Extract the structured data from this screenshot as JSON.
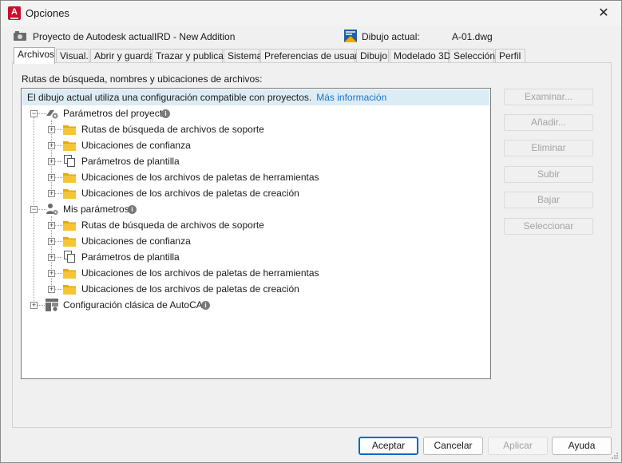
{
  "window": {
    "title": "Opciones",
    "app_icon": "autocad-icon"
  },
  "infobar": {
    "project_label": "Proyecto de Autodesk actual:",
    "project_value": "IRD - New Addition",
    "drawing_label": "Dibujo actual:",
    "drawing_value": "A-01.dwg"
  },
  "tabs": [
    {
      "label": "Archivos",
      "active": true
    },
    {
      "label": "Visual.",
      "active": false
    },
    {
      "label": "Abrir y guardar",
      "active": false
    },
    {
      "label": "Trazar y publicar",
      "active": false
    },
    {
      "label": "Sistema",
      "active": false
    },
    {
      "label": "Preferencias de usuario",
      "active": false
    },
    {
      "label": "Dibujo",
      "active": false
    },
    {
      "label": "Modelado 3D",
      "active": false
    },
    {
      "label": "Selección",
      "active": false
    },
    {
      "label": "Perfil",
      "active": false
    }
  ],
  "panel": {
    "label": "Rutas de búsqueda, nombres y ubicaciones de archivos:"
  },
  "banner": {
    "text": "El dibujo actual utiliza una configuración compatible con proyectos.",
    "link": "Más información"
  },
  "tree": {
    "project_settings": {
      "label": "Parámetros del proyecto",
      "children": [
        {
          "label": "Rutas de búsqueda de archivos de soporte",
          "icon": "folder-icon"
        },
        {
          "label": "Ubicaciones de confianza",
          "icon": "folder-icon"
        },
        {
          "label": "Parámetros de plantilla",
          "icon": "template-icon"
        },
        {
          "label": "Ubicaciones de los archivos de paletas de herramientas",
          "icon": "folder-icon"
        },
        {
          "label": "Ubicaciones de los archivos de paletas de creación",
          "icon": "folder-icon"
        }
      ]
    },
    "my_settings": {
      "label": "Mis parámetros",
      "children": [
        {
          "label": "Rutas de búsqueda de archivos de soporte",
          "icon": "folder-icon"
        },
        {
          "label": "Ubicaciones de confianza",
          "icon": "folder-icon"
        },
        {
          "label": "Parámetros de plantilla",
          "icon": "template-icon"
        },
        {
          "label": "Ubicaciones de los archivos de paletas de herramientas",
          "icon": "folder-icon"
        },
        {
          "label": "Ubicaciones de los archivos de paletas de creación",
          "icon": "folder-icon"
        }
      ]
    },
    "classic": {
      "label": "Configuración clásica de AutoCAD"
    }
  },
  "side_buttons": {
    "browse": "Examinar...",
    "add": "Añadir...",
    "remove": "Eliminar",
    "up": "Subir",
    "down": "Bajar",
    "select": "Seleccionar"
  },
  "footer": {
    "ok": "Aceptar",
    "cancel": "Cancelar",
    "apply": "Aplicar",
    "help": "Ayuda"
  },
  "colors": {
    "accent": "#0067c0",
    "banner_bg": "#dcecf5",
    "link": "#1a73c8",
    "folder": "#f5b800",
    "app_red": "#c8102e"
  }
}
